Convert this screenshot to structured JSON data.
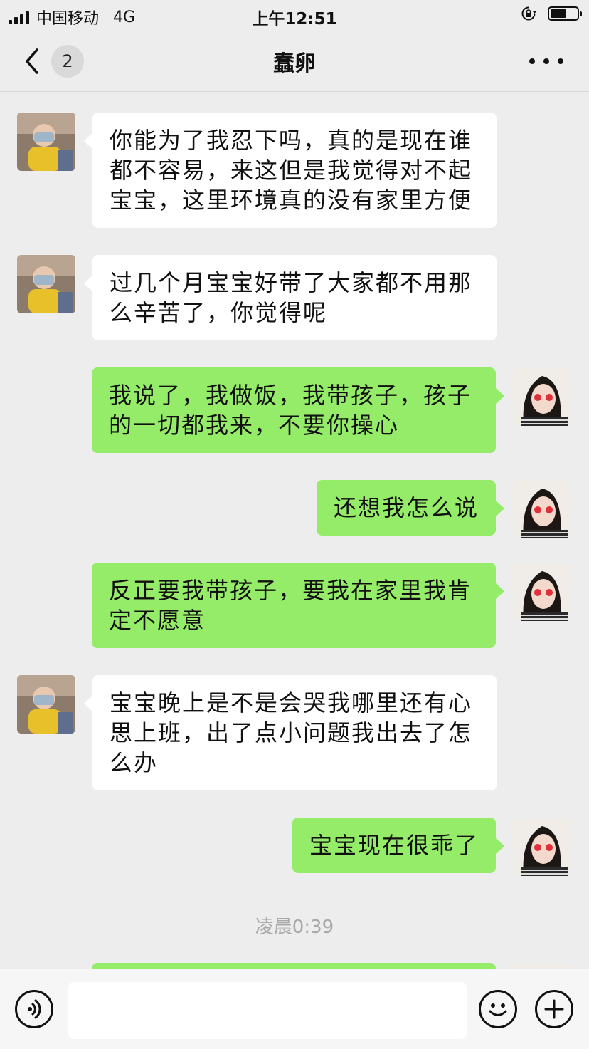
{
  "status_bar": {
    "carrier": "中国移动",
    "network": "4G",
    "time": "上午12:51",
    "battery_percent": 60
  },
  "nav": {
    "unread_count": "2",
    "title": "蠢卵"
  },
  "messages": [
    {
      "side": "left",
      "text": "你能为了我忍下吗，真的是现在谁都不容易，来这但是我觉得对不起宝宝，这里环境真的没有家里方便"
    },
    {
      "side": "left",
      "text": "过几个月宝宝好带了大家都不用那么辛苦了，你觉得呢"
    },
    {
      "side": "right",
      "text": "我说了，我做饭，我带孩子，孩子的一切都我来，不要你操心"
    },
    {
      "side": "right",
      "text": "还想我怎么说"
    },
    {
      "side": "right",
      "text": "反正要我带孩子，要我在家里我肯定不愿意"
    },
    {
      "side": "left",
      "text": "宝宝晚上是不是会哭我哪里还有心思上班，出了点小问题我出去了怎么办"
    },
    {
      "side": "right",
      "text": "宝宝现在很乖了"
    }
  ],
  "timestamp": "凌晨0:39",
  "colors": {
    "background": "#ededed",
    "sent_bubble": "#95ec69",
    "received_bubble": "#ffffff"
  }
}
